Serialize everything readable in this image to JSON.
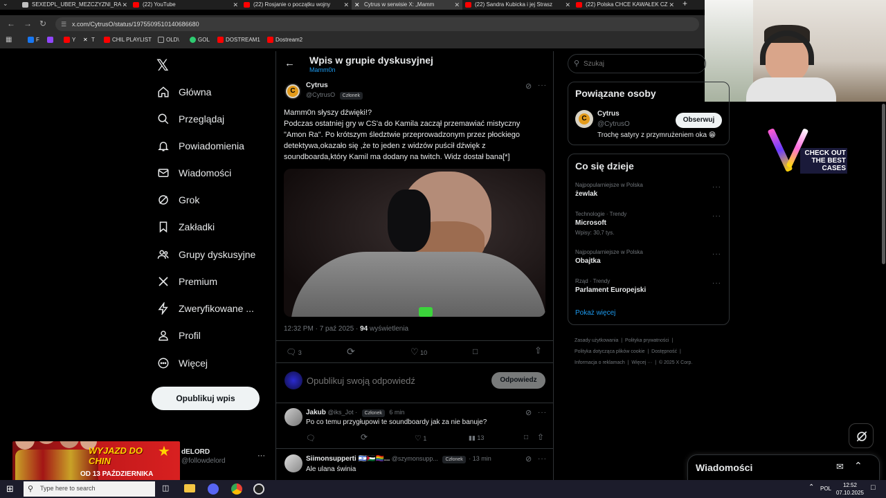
{
  "tabs": [
    {
      "label": "SEXEDPL_UBER_MEZCZYZNI_RA",
      "color": "#c0c0c0"
    },
    {
      "label": "(22) YouTube",
      "color": "#ff0000"
    },
    {
      "label": "(22) Rosjanie o początku wojny",
      "color": "#ff0000"
    },
    {
      "label": "Cytrus w serwisie X: „Mamm",
      "color": "#ffffff"
    },
    {
      "label": "(22) Sandra Kubicka i jej Strasz",
      "color": "#ff0000"
    },
    {
      "label": "(22) Polska CHCE KAWAŁEK CZ",
      "color": "#ff0000"
    }
  ],
  "address": {
    "url": "x.com/CytrusO/status/1975509510140686680"
  },
  "bookmarks": [
    {
      "label": "F",
      "color": "#1877f2"
    },
    {
      "label": "",
      "color": "#9146ff"
    },
    {
      "label": "Y",
      "color": "#ff0000"
    },
    {
      "label": "T",
      "color": "#ffffff"
    },
    {
      "label": "CHIL PLAYLIST",
      "color": "#ff0000"
    },
    {
      "label": "OLD\\",
      "color": "#aaaaaa"
    },
    {
      "label": "GOL",
      "color": "#2ecc71"
    },
    {
      "label": "DOSTREAM1",
      "color": "#ff0000"
    },
    {
      "label": "Dostream2",
      "color": "#ff0000"
    }
  ],
  "nav": {
    "home": "Główna",
    "explore": "Przeglądaj",
    "notifications": "Powiadomienia",
    "messages": "Wiadomości",
    "grok": "Grok",
    "bookmarks": "Zakładki",
    "communities": "Grupy dyskusyjne",
    "premium": "Premium",
    "verified": "Zweryfikowane ...",
    "profile": "Profil",
    "more": "Więcej",
    "post_button": "Opublikuj wpis"
  },
  "account": {
    "name": "dELORD",
    "handle": "@followdelord"
  },
  "promo": {
    "line1": "WYJAZD DO CHIN",
    "line2": "OD 13 PAŹDZIERNIKA"
  },
  "header": {
    "title": "Wpis w grupie dyskusyjnej",
    "subtitle": "Mamm0n"
  },
  "post": {
    "author": "Cytrus",
    "handle": "@CytrusO",
    "badge": "Członek",
    "text": "Mamm0n słyszy dźwięki!?\nPodczas ostatniej gry w CS'a do Kamila zaczął przemawiać mistyczny \"Amon Ra\". Po krótszym śledztwie przeprowadzonym przez płockiego detektywa,okazało się ,że to jeden z widzów puścił dźwięk z soundboarda,który Kamil ma dodany na twitch. Widz dostał bana[*]",
    "time": "12:32 PM · 7 paź 2025 ·",
    "views": "94",
    "views_label": "wyświetlenia",
    "replies": "3",
    "likes": "10"
  },
  "reply_box": {
    "placeholder": "Opublikuj swoją odpowiedź",
    "button": "Odpowiedz"
  },
  "replies": [
    {
      "name": "Jakub",
      "handle": "@iks_Jot ·",
      "badge": "Członek",
      "time": "6 min",
      "text": "Po co temu przygłupowi te soundboardy jak za nie banuje?",
      "likes": "1",
      "views": "13"
    },
    {
      "name": "Siimonsupperti 🇮🇱🇵🇸🏳️‍🌈...",
      "handle": "@szymonsupp...",
      "badge": "Członek",
      "time": "· 13 min",
      "text": "Ale ulana świnia"
    }
  ],
  "search": {
    "placeholder": "Szukaj"
  },
  "related": {
    "title": "Powiązane osoby",
    "name": "Cytrus",
    "handle": "@CytrusO",
    "bio": "Trochę satyry z przymrużeniem oka 😁",
    "follow": "Obserwuj"
  },
  "trends": {
    "title": "Co się dzieje",
    "items": [
      {
        "meta": "Najpopularniejsze w Polska",
        "name": "żewlak",
        "extra": ""
      },
      {
        "meta": "Technologie · Trendy",
        "name": "Microsoft",
        "extra": "Wpisy: 30,7 tys."
      },
      {
        "meta": "Najpopularniejsze w Polska",
        "name": "Obajtka",
        "extra": ""
      },
      {
        "meta": "Rząd · Trendy",
        "name": "Parlament Europejski",
        "extra": ""
      }
    ],
    "show_more": "Pokaż więcej"
  },
  "footer": {
    "l1a": "Zasady użytkowania",
    "l1b": "Polityka prywatności",
    "l2a": "Polityka dotycząca plików cookie",
    "l2b": "Dostępność",
    "l3a": "Informacja o reklamach",
    "l3b": "Więcej ···",
    "l3c": "© 2025 X Corp."
  },
  "messages_drawer": {
    "title": "Wiadomości"
  },
  "ad": {
    "text": "CHECK OUT THE BEST CASES"
  },
  "taskbar": {
    "search": "Type here to search",
    "lang": "POL",
    "time": "12:52",
    "date": "07.10.2025"
  }
}
